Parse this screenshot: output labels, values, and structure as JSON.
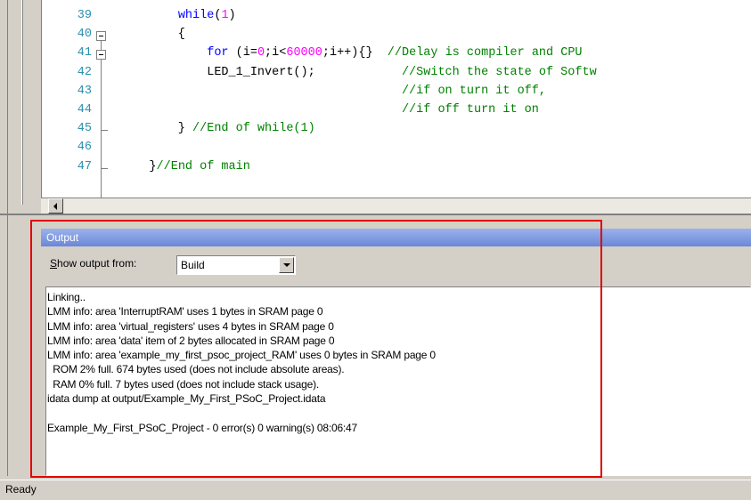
{
  "editor": {
    "lines": [
      {
        "num": "39",
        "fold": "",
        "segments": [
          {
            "t": "        "
          },
          {
            "t": "while",
            "c": "kw"
          },
          {
            "t": "("
          },
          {
            "t": "1",
            "c": "num"
          },
          {
            "t": ")"
          }
        ]
      },
      {
        "num": "40",
        "fold": "box",
        "segments": [
          {
            "t": "        {"
          }
        ]
      },
      {
        "num": "41",
        "fold": "box",
        "segments": [
          {
            "t": "            "
          },
          {
            "t": "for",
            "c": "kw"
          },
          {
            "t": " (i="
          },
          {
            "t": "0",
            "c": "num"
          },
          {
            "t": ";i<"
          },
          {
            "t": "60000",
            "c": "num"
          },
          {
            "t": ";i++){}  "
          },
          {
            "t": "//Delay is compiler and CPU",
            "c": "cm"
          }
        ]
      },
      {
        "num": "42",
        "fold": "",
        "segments": [
          {
            "t": "            LED_1_Invert();            "
          },
          {
            "t": "//Switch the state of Softw",
            "c": "cm"
          }
        ]
      },
      {
        "num": "43",
        "fold": "",
        "segments": [
          {
            "t": "                                       "
          },
          {
            "t": "//if on turn it off,",
            "c": "cm"
          }
        ]
      },
      {
        "num": "44",
        "fold": "",
        "segments": [
          {
            "t": "                                       "
          },
          {
            "t": "//if off turn it on",
            "c": "cm"
          }
        ]
      },
      {
        "num": "45",
        "fold": "end",
        "segments": [
          {
            "t": "        } "
          },
          {
            "t": "//End of while(1)",
            "c": "cm"
          }
        ]
      },
      {
        "num": "46",
        "fold": "",
        "segments": [
          {
            "t": ""
          }
        ]
      },
      {
        "num": "47",
        "fold": "end",
        "segments": [
          {
            "t": "    }"
          },
          {
            "t": "//End of main",
            "c": "cm"
          }
        ]
      }
    ]
  },
  "output": {
    "title": "Output",
    "show_output_label_prefix": "S",
    "show_output_label_rest": "how output from:",
    "source_selected": "Build",
    "lines": [
      "Linking..",
      "LMM info: area 'InterruptRAM' uses 1 bytes in SRAM page 0",
      "LMM info: area 'virtual_registers' uses 4 bytes in SRAM page 0",
      "LMM info: area 'data' item of 2 bytes allocated in SRAM page 0",
      "LMM info: area 'example_my_first_psoc_project_RAM' uses 0 bytes in SRAM page 0",
      "  ROM 2% full. 674 bytes used (does not include absolute areas).",
      "  RAM 0% full. 7 bytes used (does not include stack usage).",
      "idata dump at output/Example_My_First_PSoC_Project.idata",
      "",
      "Example_My_First_PSoC_Project - 0 error(s) 0 warning(s) 08:06:47"
    ]
  },
  "statusbar": {
    "text": "Ready"
  },
  "colors": {
    "highlight": "#e00000",
    "titlebar": "#7a96df"
  }
}
